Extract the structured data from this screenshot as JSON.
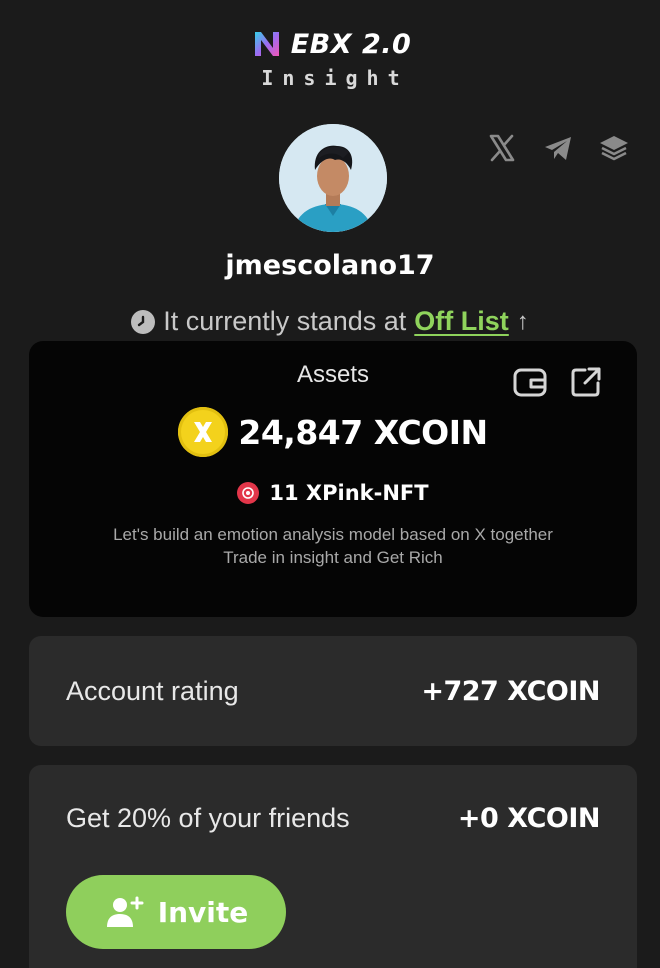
{
  "brand": {
    "title": "EBX 2.0",
    "subtitle": "Insight"
  },
  "socials": [
    {
      "icon": "x-icon"
    },
    {
      "icon": "telegram-icon"
    },
    {
      "icon": "layers-icon"
    }
  ],
  "profile": {
    "username": "jmescolano17",
    "standing_prefix": "It currently stands at",
    "standing_status": "Off List",
    "standing_arrow": "↑"
  },
  "assets": {
    "title": "Assets",
    "balance": "24,847 XCOIN",
    "nft": "11 XPink-NFT",
    "tagline_line1": "Let's build an emotion analysis model based on X together",
    "tagline_line2": "Trade in insight and Get Rich"
  },
  "rating": {
    "label": "Account rating",
    "value": "+727 XCOIN"
  },
  "referral": {
    "label": "Get 20% of your friends",
    "value": "+0 XCOIN",
    "button_label": "Invite"
  },
  "colors": {
    "accent_green": "#8fcf5c",
    "coin_yellow": "#f3d21c",
    "nft_red": "#e3364a",
    "card_bg": "#2b2b2b",
    "assets_bg": "#050505"
  }
}
